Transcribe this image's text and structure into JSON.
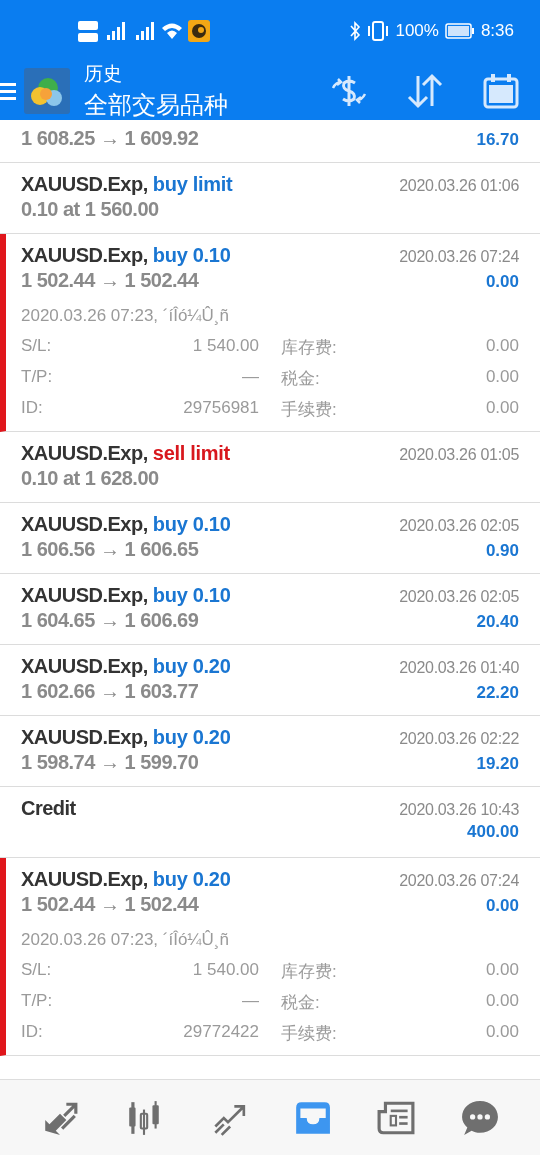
{
  "status_bar": {
    "battery": "100%",
    "time": "8:36"
  },
  "header": {
    "title": "历史",
    "subtitle": "全部交易品种"
  },
  "rows": [
    {
      "kind": "partial",
      "prices": "1 608.25 → 1 609.92",
      "profit": "16.70",
      "expanded": false
    },
    {
      "kind": "deal",
      "symbol": "XAUUSD.Exp,",
      "action": "buy limit",
      "color": "#1a76d2",
      "time": "2020.03.26 01:06",
      "prices": "0.10 at 1 560.00",
      "expanded": false
    },
    {
      "kind": "deal",
      "symbol": "XAUUSD.Exp,",
      "action": "buy 0.10",
      "color": "#1a76d2",
      "time": "2020.03.26 07:24",
      "prices": "1 502.44 → 1 502.44",
      "profit": "0.00",
      "expanded": true,
      "comment": "2020.03.26 07:23, ´íÎó¼Û¸ñ",
      "details": [
        {
          "label": "S/L:",
          "value": "1 540.00"
        },
        {
          "label": "库存费:",
          "value": "0.00"
        },
        {
          "label": "T/P:",
          "value": "—"
        },
        {
          "label": "税金:",
          "value": "0.00"
        },
        {
          "label": "ID:",
          "value": "29756981"
        },
        {
          "label": "手续费:",
          "value": "0.00"
        }
      ]
    },
    {
      "kind": "deal",
      "symbol": "XAUUSD.Exp,",
      "action": "sell limit",
      "color": "#d8171d",
      "time": "2020.03.26 01:05",
      "prices": "0.10 at 1 628.00",
      "expanded": false
    },
    {
      "kind": "deal",
      "symbol": "XAUUSD.Exp,",
      "action": "buy 0.10",
      "color": "#1a76d2",
      "time": "2020.03.26 02:05",
      "prices": "1 606.56 → 1 606.65",
      "profit": "0.90",
      "expanded": false
    },
    {
      "kind": "deal",
      "symbol": "XAUUSD.Exp,",
      "action": "buy 0.10",
      "color": "#1a76d2",
      "time": "2020.03.26 02:05",
      "prices": "1 604.65 → 1 606.69",
      "profit": "20.40",
      "expanded": false
    },
    {
      "kind": "deal",
      "symbol": "XAUUSD.Exp,",
      "action": "buy 0.20",
      "color": "#1a76d2",
      "time": "2020.03.26 01:40",
      "prices": "1 602.66 → 1 603.77",
      "profit": "22.20",
      "expanded": false
    },
    {
      "kind": "deal",
      "symbol": "XAUUSD.Exp,",
      "action": "buy 0.20",
      "color": "#1a76d2",
      "time": "2020.03.26 02:22",
      "prices": "1 598.74 → 1 599.70",
      "profit": "19.20",
      "expanded": false
    },
    {
      "kind": "balance",
      "symbol": "Credit",
      "time": "2020.03.26 10:43",
      "profit": "400.00",
      "expanded": false
    },
    {
      "kind": "deal",
      "symbol": "XAUUSD.Exp,",
      "action": "buy 0.20",
      "color": "#1a76d2",
      "time": "2020.03.26 07:24",
      "prices": "1 502.44 → 1 502.44",
      "profit": "0.00",
      "expanded": true,
      "comment": "2020.03.26 07:23, ´íÎó¼Û¸ñ",
      "details": [
        {
          "label": "S/L:",
          "value": "1 540.00"
        },
        {
          "label": "库存费:",
          "value": "0.00"
        },
        {
          "label": "T/P:",
          "value": "—"
        },
        {
          "label": "税金:",
          "value": "0.00"
        },
        {
          "label": "ID:",
          "value": "29772422"
        },
        {
          "label": "手续费:",
          "value": "0.00"
        }
      ]
    }
  ],
  "nav": [
    {
      "selected": false
    },
    {
      "selected": false
    },
    {
      "selected": false
    },
    {
      "selected": true
    },
    {
      "selected": false
    },
    {
      "selected": false
    }
  ]
}
